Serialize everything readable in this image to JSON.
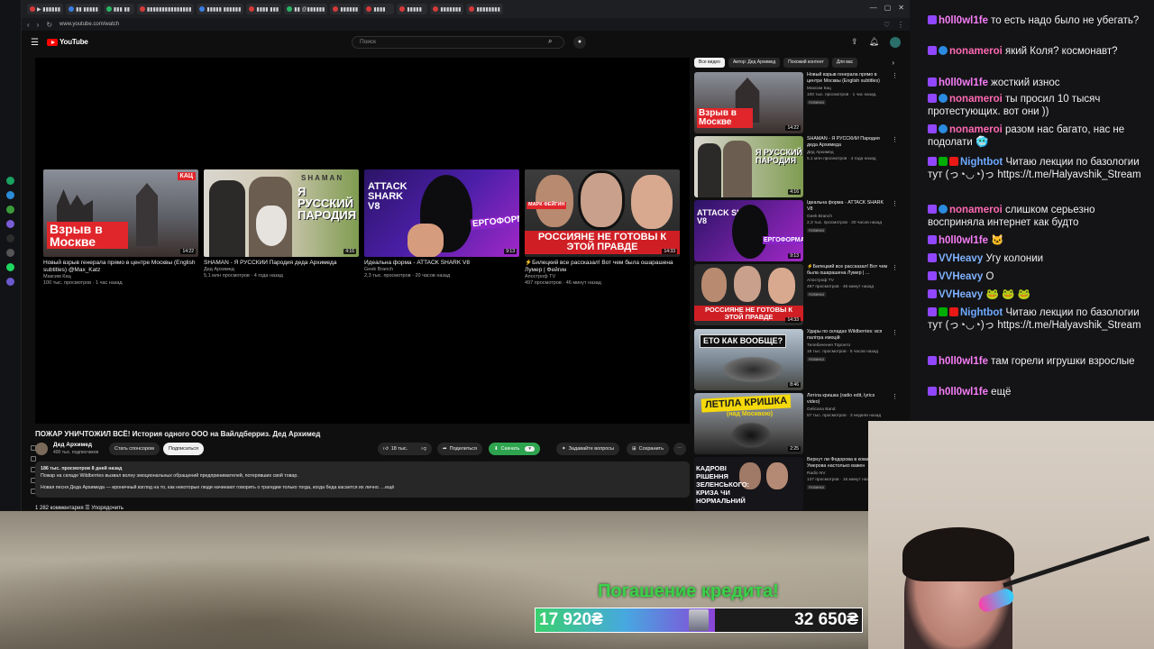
{
  "browser": {
    "url": "www.youtube.com/watch",
    "tabs": [
      "▶ ▮▮▮▮▮▮",
      "▮▮ ▮▮▮▮▮",
      "▮▮▮ ▮▮",
      "▮▮▮▮▮▮▮▮▮▮▮▮▮▮▮",
      "▮▮▮▮▮ ▮▮▮▮▮▮",
      "▮▮▮▮ ▮▮▮",
      "▮▮ @▮▮▮▮▮▮",
      "▮▮▮▮▮▮",
      "▮▮▮▮",
      "▮▮▮▮▮",
      "▮▮▮▮▮▮▮",
      "▮▮▮▮▮▮▮▮"
    ],
    "colors": {
      "tab_fav_a": "#d33a3a",
      "tab_fav_b": "#3b7de0",
      "tab_fav_c": "#28b463"
    }
  },
  "youtube": {
    "logo": "YouTube",
    "search_placeholder": "Поиск",
    "end_cards": [
      {
        "title": "Новый взрыв генерала прямо в центре Москвы (English subtitles) @Max_Katz",
        "channel": "Максим Кац",
        "meta": "100 тыс. просмотров · 1 час назад",
        "duration": "14:22",
        "overlay": "Взрыв в Москве",
        "tag": "КАЦ"
      },
      {
        "title": "SHAMAN - Я РУССКИЙ Пародия деда Архимеда",
        "channel": "Дед Архимед",
        "meta": "5,1 млн просмотров · 4 года назад",
        "duration": "4:16",
        "overlay": "Я РУССКИЙ ПАРОДИЯ",
        "tag": "SHAMAN"
      },
      {
        "title": "Идеальна форма - ATTACK SHARK V8",
        "channel": "Geek Branch",
        "meta": "2,3 тыс. просмотров · 20 часов назад",
        "duration": "9:13",
        "overlay": "ATTACK SHARK V8",
        "tag": "ЕРГОФОРМА"
      },
      {
        "title": "⚡Билецкий все рассказал! Вот чем была ошарашена Лумер | Фейгин",
        "channel": "Апостроф TV",
        "meta": "497 просмотров · 46 минут назад",
        "duration": "14:33",
        "overlay": "РОССИЯНЕ НЕ ГОТОВЫ К ЭТОЙ ПРАВДЕ",
        "tag": "МАРК ФЕЙГИН"
      }
    ],
    "video": {
      "title": "ПОЖАР УНИЧТОЖИЛ ВСЁ! История одного ООО на Вайлдберриз. Дед Архимед",
      "channel": "Дед Архимед",
      "subscribers": "400 тыс. подписчиков",
      "sponsor_label": "Стать спонсором",
      "subscribe_label": "Подписаться",
      "likes": "18 тыс.",
      "share_label": "Поделиться",
      "download_label": "Скачать",
      "ask_label": "Задавайте вопросы",
      "save_label": "Сохранить",
      "desc_line1": "186 тыс. просмотров  8 дней назад",
      "desc_line2": "Пожар на складе Wildberries вызвал волну эмоциональных обращений предпринимателей, потерявших свой товар.",
      "desc_line3": "Новая песня Деда Архимеда — ироничный взгляд на то, как некоторые люди начинают говорить о трагедии только тогда, когда беда касается их лично.  ...ещё",
      "comments_label": "1 282 комментария    ☰ Упорядочить"
    },
    "chips": [
      "Все видео",
      "Автор: Дед Архимед",
      "Похожий контент",
      "Для вас"
    ],
    "recommendations": [
      {
        "title": "Новый взрыв генерала прямо в центре Москвы (English subtitles)",
        "channel": "Максим Кац",
        "meta": "100 тыс. просмотров · 1 час назад",
        "badge": "Новинка",
        "duration": "14:22",
        "overlay": "Взрыв в Москве"
      },
      {
        "title": "SHAMAN - Я РУССКИЙ Пародия деда Архимеда",
        "channel": "Дед Архимед",
        "meta": "5,1 млн просмотров · 4 года назад",
        "badge": "",
        "duration": "4:16",
        "overlay": "Я РУССКИЙ ПАРОДИЯ"
      },
      {
        "title": "Ідеальна форма - ATTACK SHARK V8",
        "channel": "Geek Branch",
        "meta": "2,3 тыс. просмотров · 20 часов назад",
        "badge": "Новинка",
        "duration": "9:13",
        "overlay": "ЕРГОФОРМА"
      },
      {
        "title": "⚡Билецкий все рассказал! Вот чем была ошарашена Лумер | ...",
        "channel": "Апостроф TV",
        "meta": "497 просмотров · 46 минут назад",
        "badge": "Новинка",
        "duration": "14:33",
        "overlay": "РОССИЯНЕ НЕ ГОТОВЫ К ЭТОЙ ПРАВДЕ"
      },
      {
        "title": "Удары по складах Wildberries: вся палітра емоцій",
        "channel": "Телебачення Торонто",
        "meta": "15 тыс. просмотров · 5 часов назад",
        "badge": "Новинка",
        "duration": "8:46",
        "overlay": "ЕТО КАК ВООБЩЕ?"
      },
      {
        "title": "Летіла кришка (radio edit, lyrics video)",
        "channel": "Gelicana Band",
        "meta": "57 тыс. просмотров · 3 недели назад",
        "badge": "",
        "duration": "2:25",
        "overlay": "ЛЕТІЛА КРИШКА"
      },
      {
        "title": "Вернут ли Федорова в команду Умерова настолько важен",
        "channel": "Radio NV",
        "meta": "137 просмотров · 16 минут назад",
        "badge": "Новинка",
        "duration": "",
        "overlay": "КАДРОВІ РІШЕННЯ ЗЕЛЕНСЬКОГО: КРИЗА ЧИ НОРМАЛЬНИЙ"
      }
    ]
  },
  "chat": {
    "messages": [
      {
        "user": "h0ll0wl1fe",
        "color": "#f77ef7",
        "text": "то есть надо было не убегать?"
      },
      {
        "user": "nonameroi",
        "color": "#ff69b4",
        "text": "який Коля? космонавт?"
      },
      {
        "user": "h0ll0wl1fe",
        "color": "#f77ef7",
        "text": "жосткий износ"
      },
      {
        "user": "nonameroi",
        "color": "#ff69b4",
        "text": "ты просил 10 тысяч протестующих. вот они ))"
      },
      {
        "user": "nonameroi",
        "color": "#ff69b4",
        "text": "разом нас багато, нас не подолати 🥶"
      },
      {
        "user": "Nightbot",
        "color": "#6ea9ff",
        "text": "Читаю лекции по базологии тут (っ◔◡◔)っ https://t.me/Halyavshik_Stream"
      },
      {
        "user": "nonameroi",
        "color": "#ff69b4",
        "text": "слишком серьезно восприняла интернет как будто"
      },
      {
        "user": "h0ll0wl1fe",
        "color": "#f77ef7",
        "text": "🐱"
      },
      {
        "user": "VVHeavy",
        "color": "#7fb2ff",
        "text": "Угу колонии"
      },
      {
        "user": "VVHeavy",
        "color": "#7fb2ff",
        "text": "О"
      },
      {
        "user": "VVHeavy",
        "color": "#7fb2ff",
        "text": "🐸 🐸 🐸"
      },
      {
        "user": "Nightbot",
        "color": "#6ea9ff",
        "text": "Читаю лекции по базологии тут (っ◔◡◔)っ https://t.me/Halyavshik_Stream"
      },
      {
        "user": "h0ll0wl1fe",
        "color": "#f77ef7",
        "text": "там горели игрушки взрослые"
      },
      {
        "user": "h0ll0wl1fe",
        "color": "#f77ef7",
        "text": "ещё"
      }
    ]
  },
  "goal": {
    "title": "Погашение кредита!",
    "current": "17 920₴",
    "target": "32 650₴",
    "progress": 0.55
  }
}
